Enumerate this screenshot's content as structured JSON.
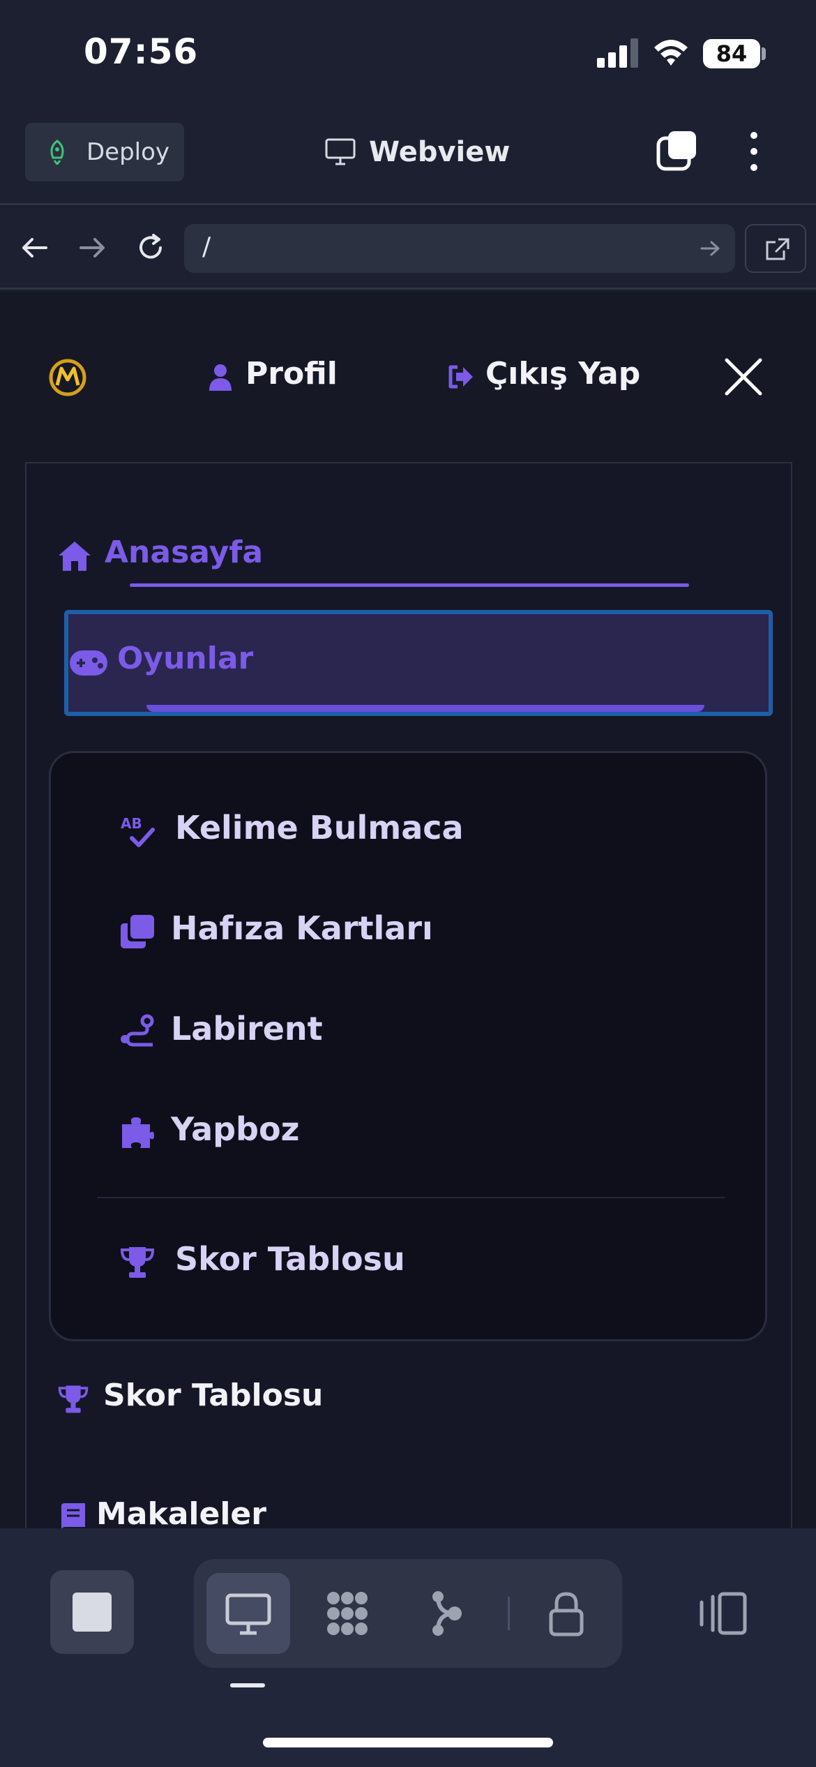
{
  "status_bar": {
    "time": "07:56",
    "battery": "84"
  },
  "toolbar": {
    "deploy_label": "Deploy",
    "webview_label": "Webview"
  },
  "url_bar": {
    "path": "/"
  },
  "topnav": {
    "profile": "Profil",
    "logout": "Çıkış Yap"
  },
  "menu": {
    "home": "Anasayfa",
    "games": "Oyunlar",
    "games_items": [
      {
        "label": "Kelime Bulmaca",
        "icon": "spell-check-icon"
      },
      {
        "label": "Hafıza Kartları",
        "icon": "clone-cards-icon"
      },
      {
        "label": "Labirent",
        "icon": "route-icon"
      },
      {
        "label": "Yapboz",
        "icon": "puzzle-icon"
      },
      {
        "label": "Skor Tablosu",
        "icon": "trophy-icon"
      }
    ],
    "scoreboard": "Skor Tablosu",
    "articles": "Makaleler"
  },
  "colors": {
    "accent": "#7b5be8",
    "page_bg": "#161826",
    "chrome_bg": "#1c2030",
    "selection_border": "#1d5fa8"
  }
}
